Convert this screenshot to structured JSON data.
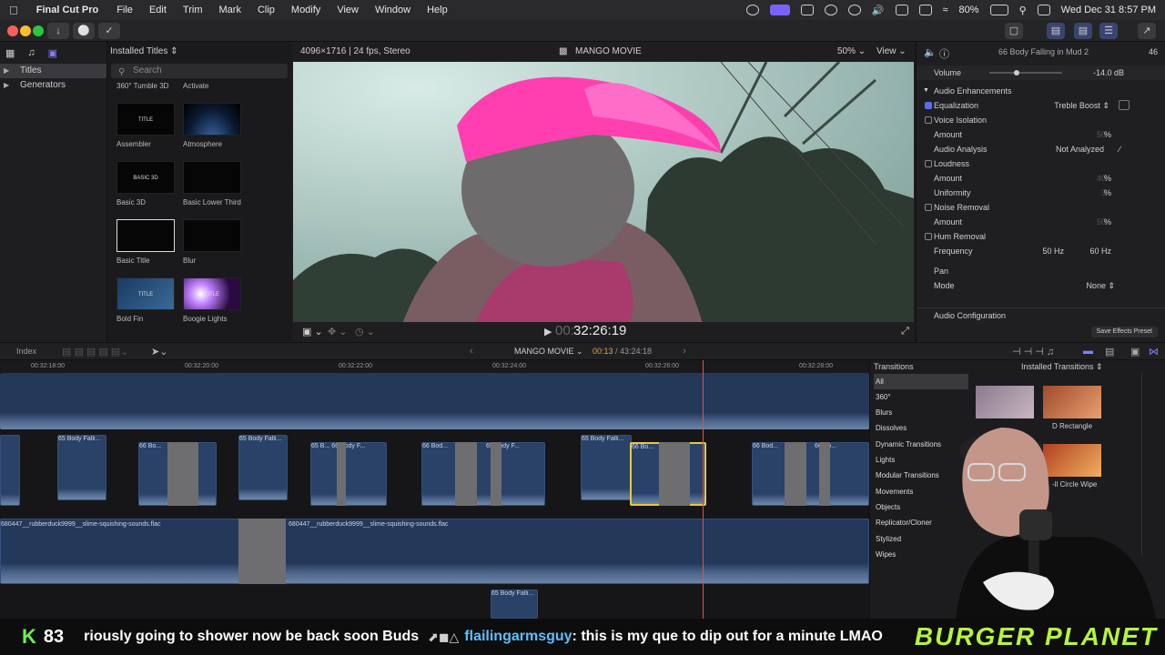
{
  "menubar": {
    "app_name": "Final Cut Pro",
    "items": [
      "File",
      "Edit",
      "Trim",
      "Mark",
      "Clip",
      "Modify",
      "View",
      "Window",
      "Help"
    ],
    "battery": "80%",
    "datetime": "Wed Dec 31  8:57 PM"
  },
  "sidebar": {
    "items": [
      {
        "label": "Titles",
        "selected": true
      },
      {
        "label": "Generators",
        "selected": false
      }
    ]
  },
  "browser": {
    "header": "Installed Titles",
    "search_placeholder": "Search",
    "top_labels": [
      "360° Tumble 3D",
      "Activate"
    ],
    "titles": [
      {
        "label": "Assembler",
        "thumb_text": "TITLE"
      },
      {
        "label": "Atmosphere",
        "thumb_text": ""
      },
      {
        "label": "Basic 3D",
        "thumb_text": "BASIC 3D"
      },
      {
        "label": "Basic Lower Third",
        "thumb_text": ""
      },
      {
        "label": "Basic Title",
        "thumb_text": ""
      },
      {
        "label": "Blur",
        "thumb_text": ""
      },
      {
        "label": "Bold Fin",
        "thumb_text": "TITLE"
      },
      {
        "label": "Boogie Lights",
        "thumb_text": "TITLE"
      }
    ]
  },
  "viewer": {
    "format": "4096×1716 | 24 fps, Stereo",
    "project": "MANGO MOVIE",
    "zoom": "50%",
    "view_label": "View",
    "timecode": "32:26:19",
    "timecode_prefix": "00:"
  },
  "inspector": {
    "clip_name": "66 Body Falling in Mud 2",
    "clip_number": "46",
    "volume_label": "Volume",
    "volume_value": "-14.0  dB",
    "audio_enhancements": "Audio Enhancements",
    "rows": [
      {
        "label": "Equalization",
        "value": "Treble Boost",
        "checkbox": true,
        "checked": true
      },
      {
        "label": "Voice Isolation",
        "value": "",
        "checkbox": true,
        "checked": false
      },
      {
        "label": "Amount",
        "value": "%",
        "dim": "50",
        "checkbox": false
      },
      {
        "label": "Audio Analysis",
        "value": "Not Analyzed",
        "checkbox": false
      },
      {
        "label": "Loudness",
        "value": "",
        "checkbox": true,
        "checked": false
      },
      {
        "label": "Amount",
        "value": "%",
        "dim": "40",
        "checkbox": false
      },
      {
        "label": "Uniformity",
        "value": "%",
        "dim": "3",
        "checkbox": false
      },
      {
        "label": "Noise Removal",
        "value": "",
        "checkbox": true,
        "checked": false
      },
      {
        "label": "Amount",
        "value": "%",
        "dim": "50",
        "checkbox": false
      },
      {
        "label": "Hum Removal",
        "value": "",
        "checkbox": true,
        "checked": false
      },
      {
        "label": "Frequency",
        "value": "60 Hz",
        "alt": "50 Hz",
        "checkbox": false
      }
    ],
    "pan_label": "Pan",
    "mode_label": "Mode",
    "mode_value": "None",
    "audio_config": "Audio Configuration",
    "save_preset": "Save Effects Preset"
  },
  "timeline": {
    "index_label": "Index",
    "project": "MANGO MOVIE",
    "position": "00:13",
    "duration": "43:24:18",
    "ruler": [
      "00:32:18:00",
      "00:32:20:00",
      "00:32:22:00",
      "00:32:24:00",
      "00:32:26:00",
      "00:32:28:00"
    ],
    "clips": [
      "65 Body Falli...",
      "66 Bo...",
      "65 Body Falli...",
      "65 B...",
      "66 Body F...",
      "66 Bod...",
      "65 Body F...",
      "65 Body Falli...",
      "66 Bo...",
      "66 Bod...",
      "66 Bo..."
    ],
    "audio_clip": "680447__rubberduck9999__slime-squishing-sounds.flac",
    "bottom_clip": "65 Body Falli..."
  },
  "transitions": {
    "header": "Transitions",
    "installed": "Installed Transitions",
    "categories": [
      "All",
      "360°",
      "Blurs",
      "Dissolves",
      "Dynamic Transitions",
      "Lights",
      "Modular Transitions",
      "Movements",
      "Objects",
      "Replicator/Cloner",
      "Stylized",
      "Wipes"
    ],
    "thumb_labels": [
      "D Rectangle",
      "-ll Circle Wipe"
    ]
  },
  "ticker": {
    "k": "K",
    "count": "83",
    "message": "riously going to shower now be back soon Buds",
    "user": "flailingarmsguy",
    "user_message": ": this is my que to dip out for a minute LMAO",
    "brand": "BURGER PLANET"
  },
  "colors": {
    "accent": "#7b61ff",
    "clip": "#2a4168",
    "playhead": "#e05050",
    "ticker_user": "#5bc0ff",
    "brand": "#b6f43a"
  }
}
